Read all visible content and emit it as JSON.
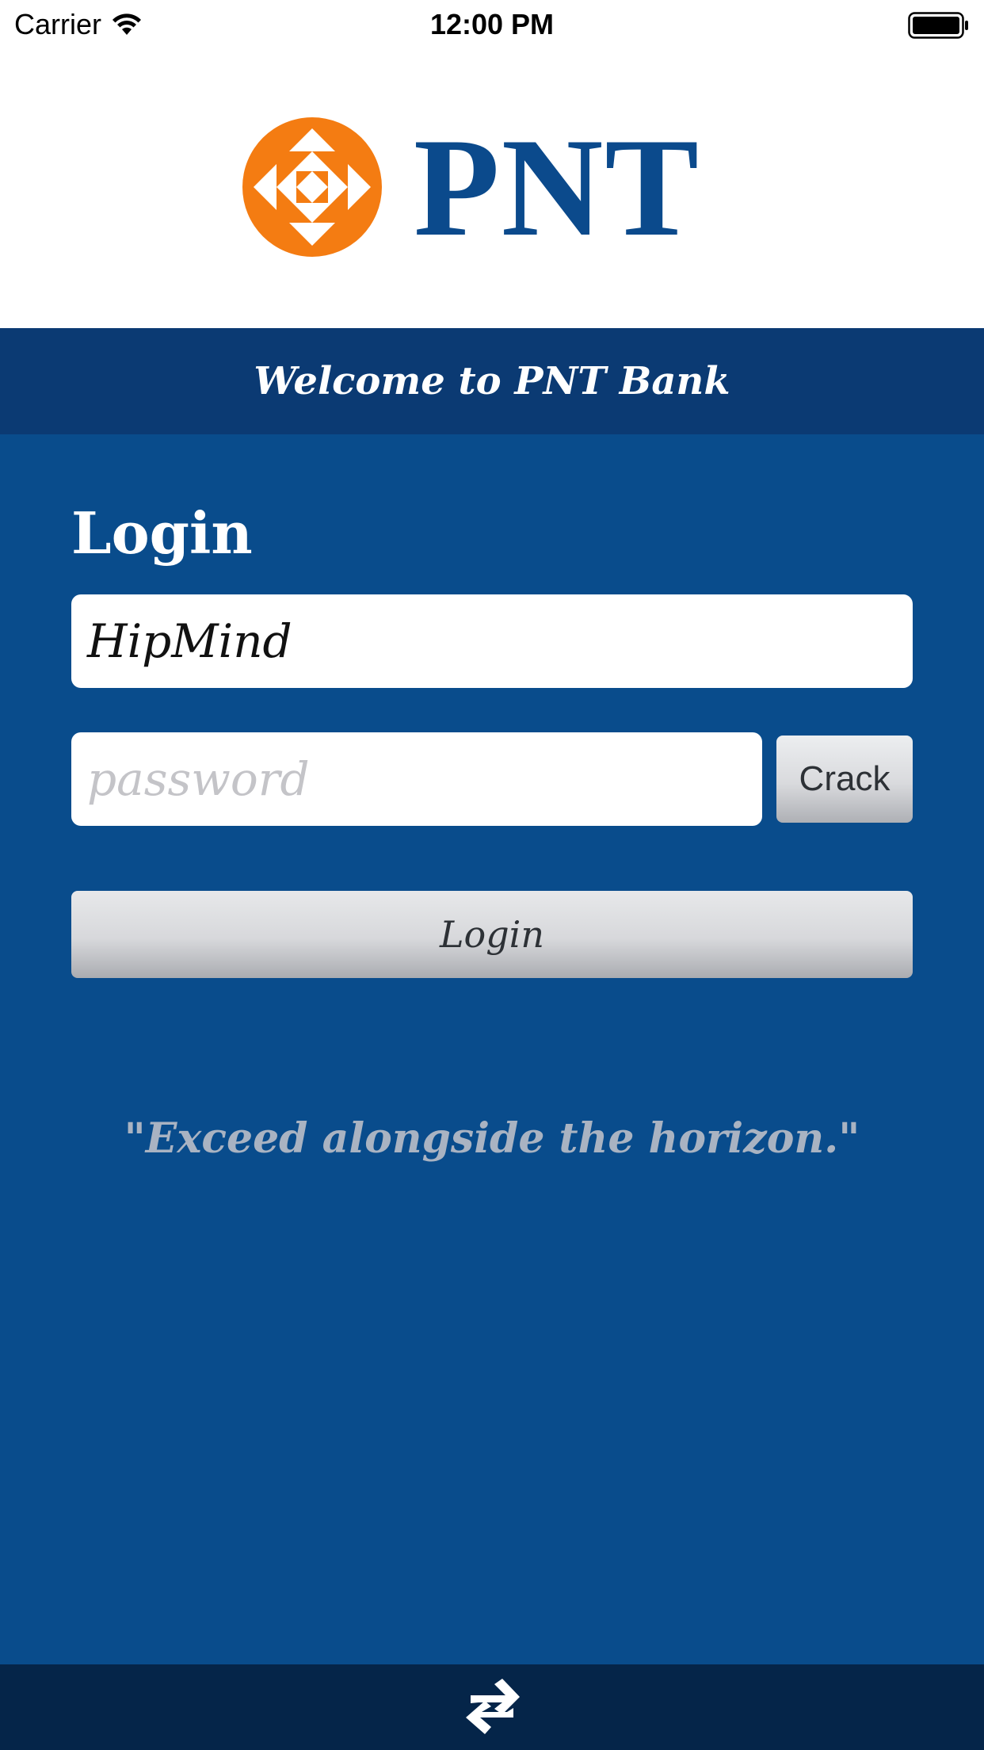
{
  "status_bar": {
    "carrier": "Carrier",
    "time": "12:00 PM"
  },
  "header": {
    "logo_text": "PNT",
    "brand_color": "#0b4a8c",
    "logo_accent_color": "#f47c12"
  },
  "banner": {
    "welcome_text": "Welcome to PNT Bank"
  },
  "login_form": {
    "heading": "Login",
    "username_value": "HipMind",
    "password_placeholder": "password",
    "crack_label": "Crack",
    "login_label": "Login"
  },
  "tagline": "\"Exceed alongside the horizon.\"",
  "bottom_bar": {
    "icon": "transfer-icon"
  }
}
